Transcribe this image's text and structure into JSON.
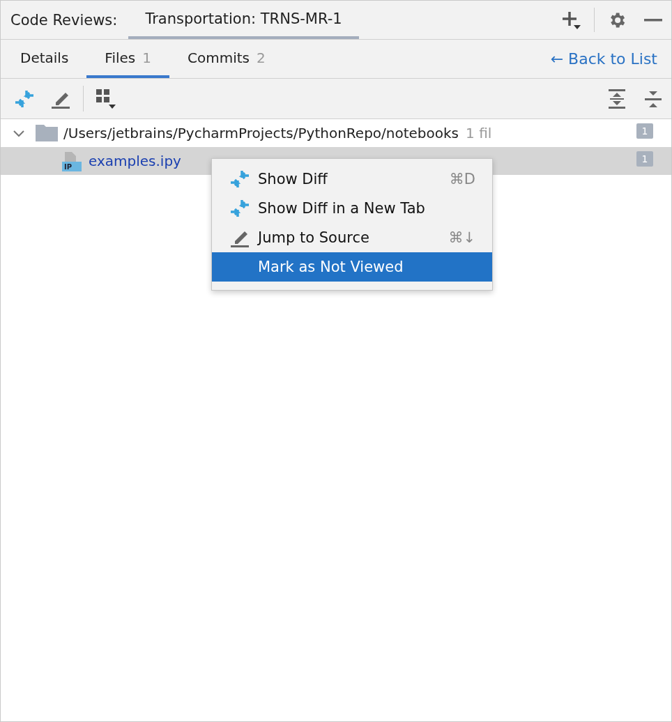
{
  "header": {
    "label": "Code Reviews:",
    "tab": {
      "label": "Transportation: TRNS-MR-1",
      "selected": true
    }
  },
  "tabs": [
    {
      "label": "Details",
      "selected": false
    },
    {
      "label": "Files",
      "count": "1",
      "selected": true
    },
    {
      "label": "Commits",
      "count": "2",
      "selected": false
    }
  ],
  "back_link": "← Back to List",
  "tree": [
    {
      "kind": "folder",
      "label": "/Users/jetbrains/PycharmProjects/PythonRepo/notebooks",
      "info": "1 fil",
      "comments": "1",
      "expanded": true,
      "selected": false,
      "children": [
        {
          "kind": "file",
          "badge": "IP",
          "label": "examples.ipy",
          "comments": "1",
          "selected": true
        }
      ]
    }
  ],
  "context_menu": [
    {
      "kind": "diff",
      "label": "Show Diff",
      "shortcut": "⌘D",
      "selected": false
    },
    {
      "kind": "diff",
      "label": "Show Diff in a New Tab",
      "selected": false
    },
    {
      "kind": "edit",
      "label": "Jump to Source",
      "shortcut": "⌘↓",
      "selected": false
    },
    {
      "kind": "plain",
      "label": "Mark as Not Viewed",
      "selected": true
    }
  ]
}
